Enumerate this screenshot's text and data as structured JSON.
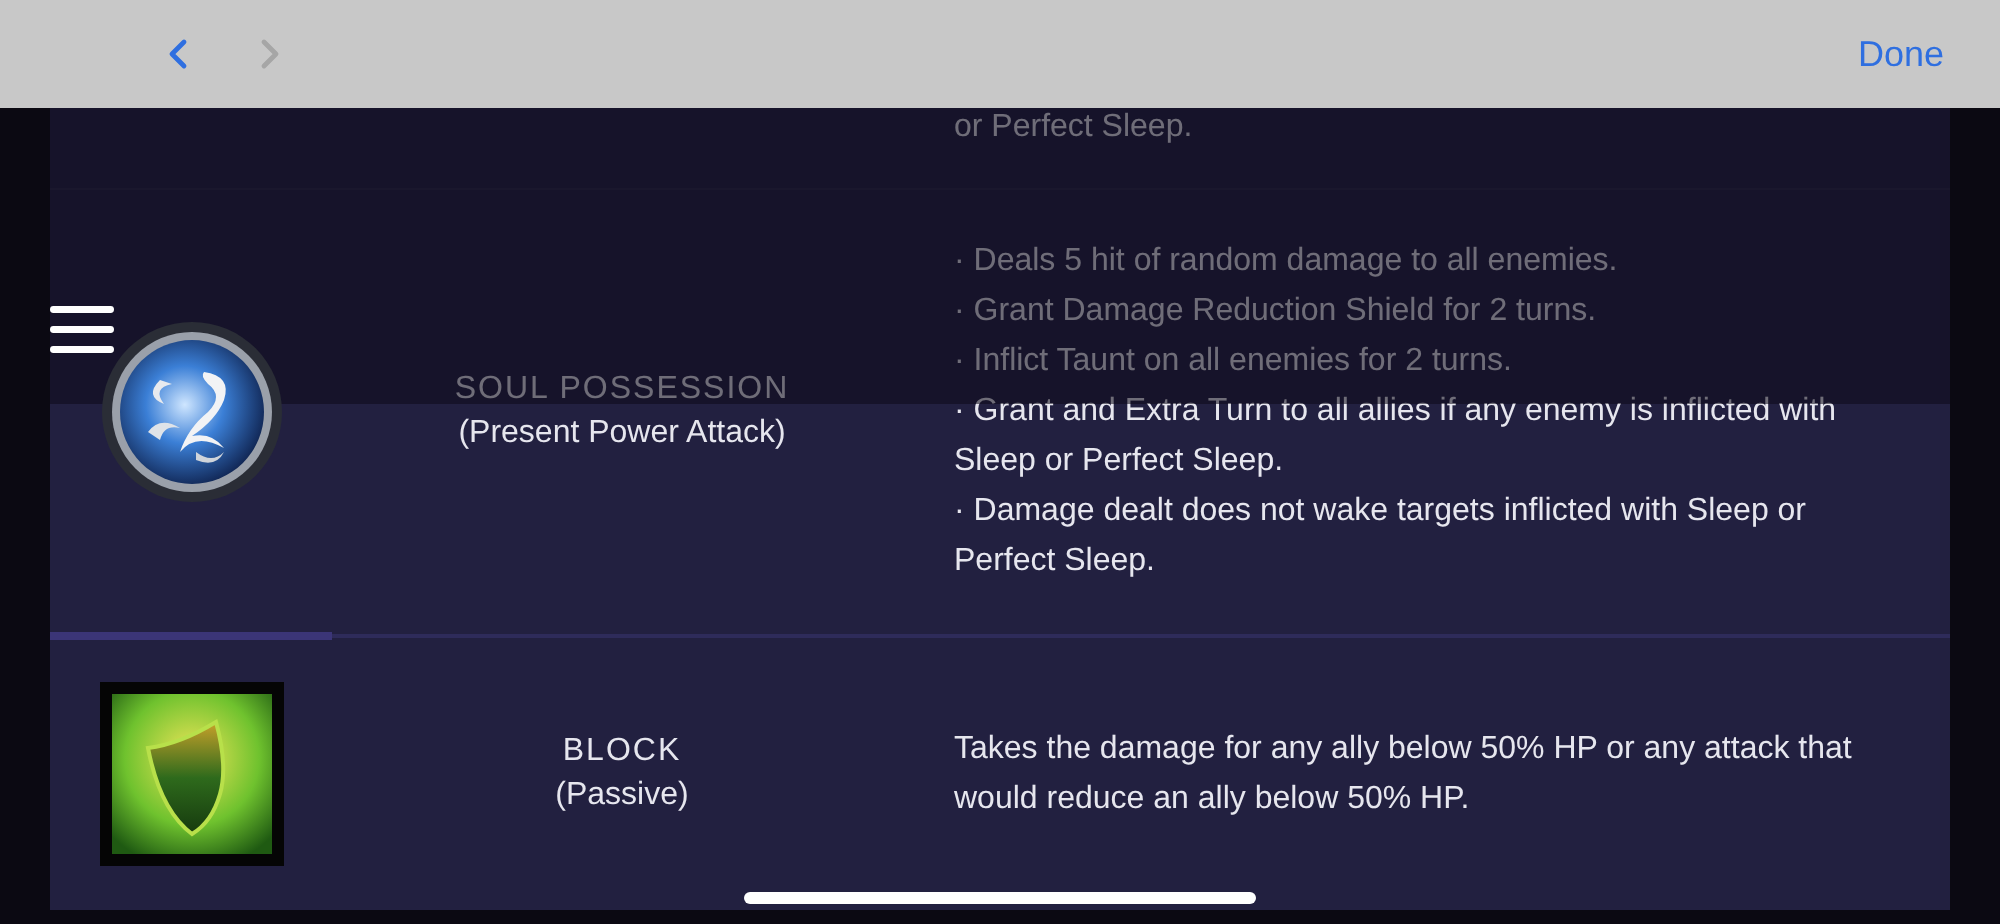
{
  "nav_buttons": [
    {
      "kind": "back",
      "disabled": false
    },
    {
      "kind": "forward",
      "disabled": true
    }
  ],
  "done_button": "Done",
  "previous_row_text": "or Perfect Sleep.",
  "skills": [
    {
      "kind": "swirl",
      "name": "SOUL POSSESSION",
      "type": "(Present Power Attack)",
      "description": [
        "· Deals 5 hit of random damage to all enemies.",
        "· Grant Damage Reduction Shield for 2 turns.",
        "· Inflict Taunt on all enemies for 2 turns.",
        "· Grant and Extra Turn to all allies if any enemy is inflicted with Sleep or Perfect Sleep.",
        "· Damage dealt does not wake targets inflicted with Sleep or Perfect Sleep."
      ]
    },
    {
      "kind": "shield",
      "name": "BLOCK",
      "type": "(Passive)",
      "description": [
        "Takes the damage for any ally below 50% HP or any attack that would reduce an ally below 50% HP."
      ]
    }
  ]
}
